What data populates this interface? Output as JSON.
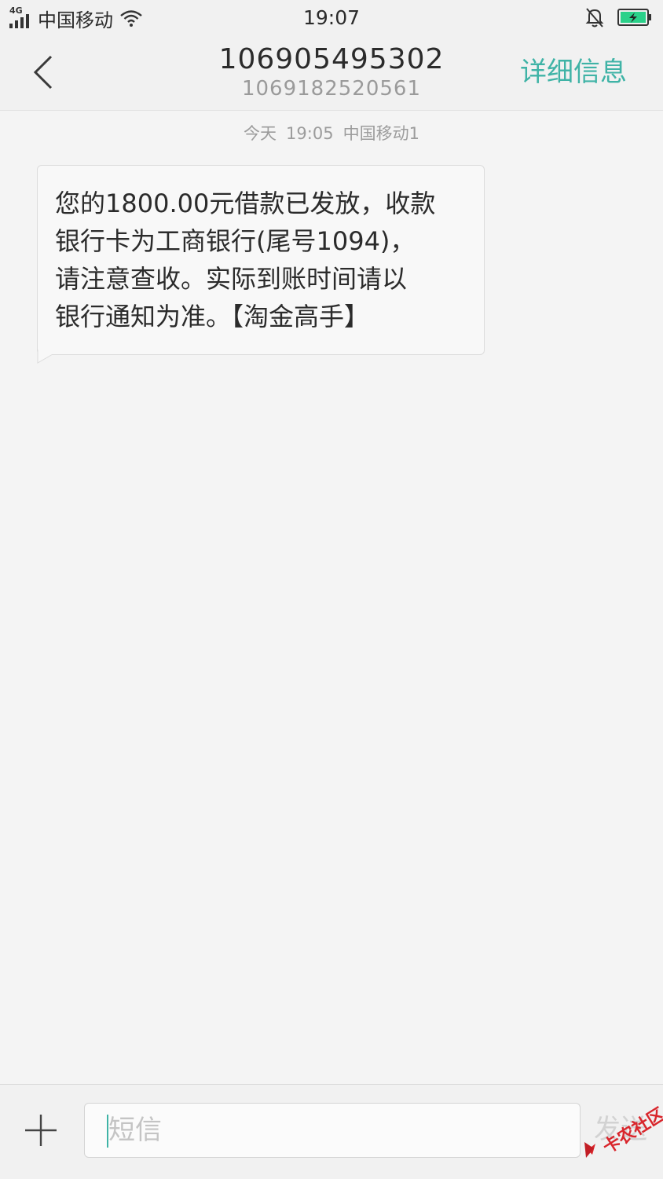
{
  "status_bar": {
    "network": "4G",
    "carrier": "中国移动",
    "time": "19:07",
    "signal_icon": "signal-bars-icon",
    "wifi_icon": "wifi-icon",
    "bell_icon": "bell-muted-icon",
    "battery_icon": "battery-charging-icon",
    "battery_color": "#2bd18a"
  },
  "header": {
    "back_icon": "chevron-left-icon",
    "title": "106905495302",
    "subtitle": "1069182520561",
    "details_label": "详细信息",
    "accent_color": "#3fb3a6"
  },
  "conversation": {
    "date": "今天",
    "time": "19:05",
    "sim": "中国移动1",
    "messages": [
      {
        "text": "您的1800.00元借款已发放，收款\n银行卡为工商银行(尾号1094)，\n请注意查收。实际到账时间请以\n银行通知为准。【淘金高手】"
      }
    ]
  },
  "composer": {
    "add_icon": "plus-icon",
    "placeholder": "短信",
    "value": "",
    "send_label": "发送"
  },
  "watermark": {
    "text": "卡农社区"
  }
}
